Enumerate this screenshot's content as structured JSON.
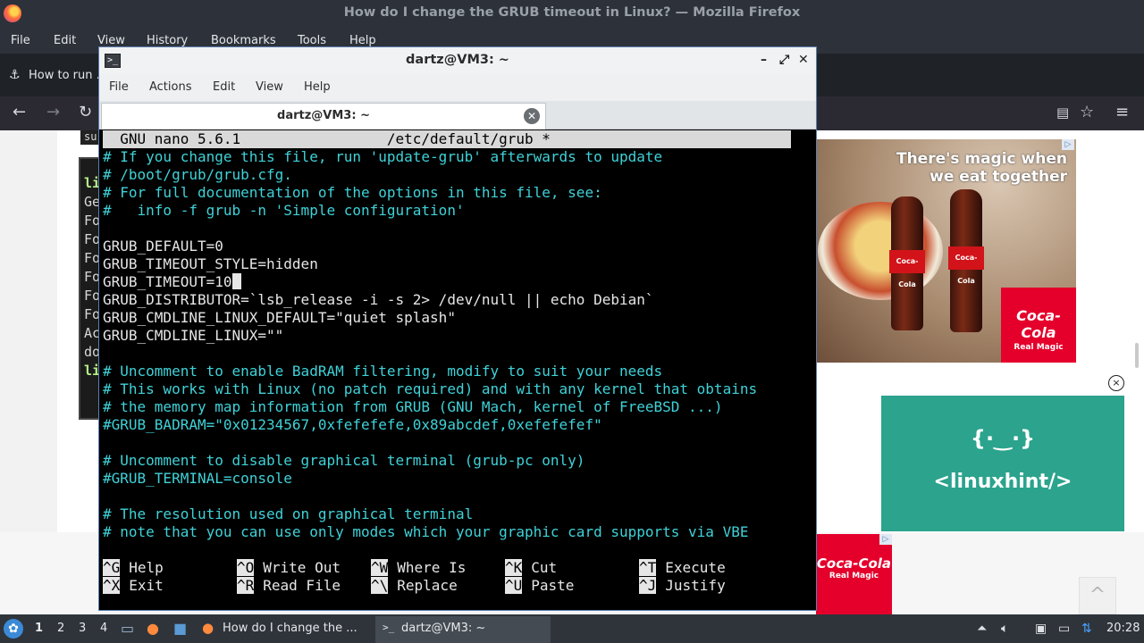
{
  "firefox": {
    "window_title": "How do I change the GRUB timeout in Linux? — Mozilla Firefox",
    "menu": [
      "File",
      "Edit",
      "View",
      "History",
      "Bookmarks",
      "Tools",
      "Help"
    ],
    "tab_label": "How to run ...",
    "win_controls": {
      "minimize": "–",
      "restore": "⤢",
      "close": "✕"
    }
  },
  "webpage": {
    "code_snippet": "su",
    "article_terminal_lines": [
      "li",
      "Ge",
      "Fo",
      "Fo",
      "Fo",
      "Fo",
      "Fo",
      "Fo",
      "Ac",
      "do",
      "li"
    ],
    "ad1": {
      "headline": "There's magic when we eat together",
      "brand": "Coca-Cola",
      "tagline": "Real Magic"
    },
    "ad2": {
      "glyph": "{·‿·}",
      "brand": "<linuxhint/>"
    },
    "ad3": {
      "brand": "Coca-Cola",
      "tagline": "Real Magic"
    },
    "close_ad": "×",
    "scroll_top": "^"
  },
  "terminal": {
    "window_title": "dartz@VM3: ~",
    "menu": [
      "File",
      "Actions",
      "Edit",
      "View",
      "Help"
    ],
    "tab_label": "dartz@VM3: ~",
    "nano": {
      "header": "  GNU nano 5.6.1                 /etc/default/grub *                          ",
      "lines": [
        {
          "text": "# If you change this file, run 'update-grub' afterwards to update",
          "type": "comment"
        },
        {
          "text": "# /boot/grub/grub.cfg.",
          "type": "comment"
        },
        {
          "text": "# For full documentation of the options in this file, see:",
          "type": "comment"
        },
        {
          "text": "#   info -f grub -n 'Simple configuration'",
          "type": "comment"
        },
        {
          "text": "",
          "type": "plain"
        },
        {
          "text": "GRUB_DEFAULT=0",
          "type": "plain"
        },
        {
          "text": "GRUB_TIMEOUT_STYLE=hidden",
          "type": "plain"
        },
        {
          "text": "GRUB_TIMEOUT=10",
          "type": "cursor"
        },
        {
          "text": "GRUB_DISTRIBUTOR=`lsb_release -i -s 2> /dev/null || echo Debian`",
          "type": "plain"
        },
        {
          "text": "GRUB_CMDLINE_LINUX_DEFAULT=\"quiet splash\"",
          "type": "plain"
        },
        {
          "text": "GRUB_CMDLINE_LINUX=\"\"",
          "type": "plain"
        },
        {
          "text": "",
          "type": "plain"
        },
        {
          "text": "# Uncomment to enable BadRAM filtering, modify to suit your needs",
          "type": "comment"
        },
        {
          "text": "# This works with Linux (no patch required) and with any kernel that obtains",
          "type": "comment"
        },
        {
          "text": "# the memory map information from GRUB (GNU Mach, kernel of FreeBSD ...)",
          "type": "comment"
        },
        {
          "text": "#GRUB_BADRAM=\"0x01234567,0xfefefefe,0x89abcdef,0xefefefef\"",
          "type": "comment"
        },
        {
          "text": "",
          "type": "plain"
        },
        {
          "text": "# Uncomment to disable graphical terminal (grub-pc only)",
          "type": "comment"
        },
        {
          "text": "#GRUB_TERMINAL=console",
          "type": "comment"
        },
        {
          "text": "",
          "type": "plain"
        },
        {
          "text": "# The resolution used on graphical terminal",
          "type": "comment"
        },
        {
          "text": "# note that you can use only modes which your graphic card supports via VBE",
          "type": "comment"
        }
      ],
      "shortcuts": [
        [
          {
            "key": "^G",
            "label": "Help"
          },
          {
            "key": "^O",
            "label": "Write Out"
          },
          {
            "key": "^W",
            "label": "Where Is"
          },
          {
            "key": "^K",
            "label": "Cut"
          },
          {
            "key": "^T",
            "label": "Execute"
          }
        ],
        [
          {
            "key": "^X",
            "label": "Exit"
          },
          {
            "key": "^R",
            "label": "Read File"
          },
          {
            "key": "^\\",
            "label": "Replace"
          },
          {
            "key": "^U",
            "label": "Paste"
          },
          {
            "key": "^J",
            "label": "Justify"
          }
        ]
      ]
    }
  },
  "taskbar": {
    "workspaces": [
      "1",
      "2",
      "3",
      "4"
    ],
    "tasks": [
      {
        "label": "How do I change the ..."
      },
      {
        "label": "dartz@VM3: ~"
      }
    ],
    "clock": "20:28"
  },
  "colors": {
    "comment": "#3fd2d8",
    "terminal_border": "#5b7fb0",
    "taskbar": "#2f343b"
  }
}
